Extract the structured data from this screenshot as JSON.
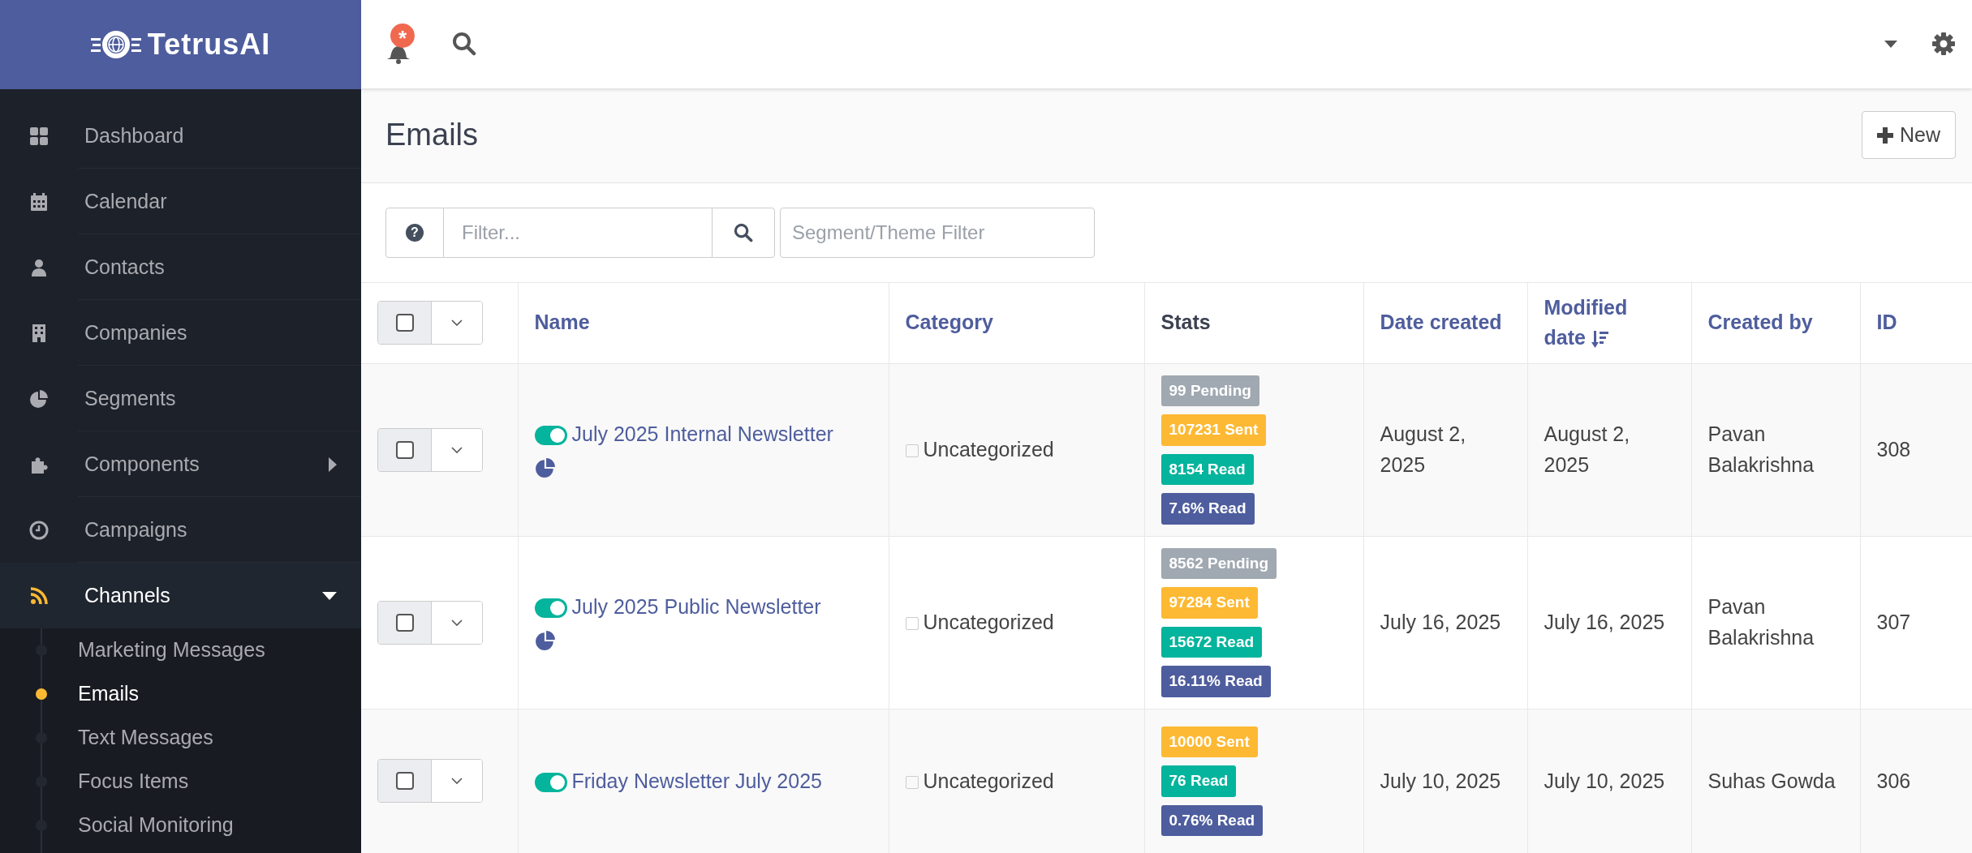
{
  "brand": {
    "name": "TetrusAI"
  },
  "sidebar": {
    "items": [
      {
        "label": "Dashboard",
        "selected": false
      },
      {
        "label": "Calendar",
        "selected": false
      },
      {
        "label": "Contacts",
        "selected": false
      },
      {
        "label": "Companies",
        "selected": false
      },
      {
        "label": "Segments",
        "selected": false
      },
      {
        "label": "Components",
        "selected": false,
        "expanded": false
      },
      {
        "label": "Campaigns",
        "selected": false
      },
      {
        "label": "Channels",
        "selected": true,
        "expanded": true,
        "children": [
          {
            "label": "Marketing Messages",
            "selected": false
          },
          {
            "label": "Emails",
            "selected": true
          },
          {
            "label": "Text Messages",
            "selected": false
          },
          {
            "label": "Focus Items",
            "selected": false
          },
          {
            "label": "Social Monitoring",
            "selected": false
          }
        ]
      }
    ]
  },
  "topbar": {
    "notification_badge": "*"
  },
  "page": {
    "title": "Emails",
    "new_button": "New"
  },
  "filters": {
    "help_icon": "?",
    "search_placeholder": "Filter...",
    "segment_placeholder": "Segment/Theme Filter"
  },
  "table": {
    "columns": [
      {
        "label": "Name",
        "sortable": true,
        "sorted": false
      },
      {
        "label": "Category",
        "sortable": true,
        "sorted": false
      },
      {
        "label": "Stats",
        "sortable": false,
        "sorted": false
      },
      {
        "label": "Date created",
        "sortable": true,
        "sorted": false
      },
      {
        "label": "Modified date",
        "sortable": true,
        "sorted": true
      },
      {
        "label": "Created by",
        "sortable": true,
        "sorted": false
      },
      {
        "label": "ID",
        "sortable": true,
        "sorted": false
      }
    ],
    "select_all_checked": false,
    "rows": [
      {
        "checked": false,
        "published": true,
        "name": "July 2025 Internal Newsletter",
        "has_segment": true,
        "category_checked": false,
        "category": "Uncategorized",
        "stats": [
          {
            "kind": "pending",
            "text": "99 Pending"
          },
          {
            "kind": "sent",
            "text": "107231 Sent"
          },
          {
            "kind": "read",
            "text": "8154 Read"
          },
          {
            "kind": "rate",
            "text": "7.6% Read"
          }
        ],
        "date_created": "August 2, 2025",
        "modified_date": "August 2, 2025",
        "created_by": "Pavan Balakrishna",
        "id": "308"
      },
      {
        "checked": false,
        "published": true,
        "name": "July 2025 Public Newsletter",
        "has_segment": true,
        "category_checked": false,
        "category": "Uncategorized",
        "stats": [
          {
            "kind": "pending",
            "text": "8562 Pending"
          },
          {
            "kind": "sent",
            "text": "97284 Sent"
          },
          {
            "kind": "read",
            "text": "15672 Read"
          },
          {
            "kind": "rate",
            "text": "16.11% Read"
          }
        ],
        "date_created": "July 16, 2025",
        "modified_date": "July 16, 2025",
        "created_by": "Pavan Balakrishna",
        "id": "307"
      },
      {
        "checked": false,
        "published": true,
        "name": "Friday Newsletter July 2025",
        "has_segment": false,
        "category_checked": false,
        "category": "Uncategorized",
        "stats": [
          {
            "kind": "sent",
            "text": "10000 Sent"
          },
          {
            "kind": "read",
            "text": "76 Read"
          },
          {
            "kind": "rate",
            "text": "0.76% Read"
          }
        ],
        "date_created": "July 10, 2025",
        "modified_date": "July 10, 2025",
        "created_by": "Suhas Gowda",
        "id": "306"
      }
    ]
  }
}
